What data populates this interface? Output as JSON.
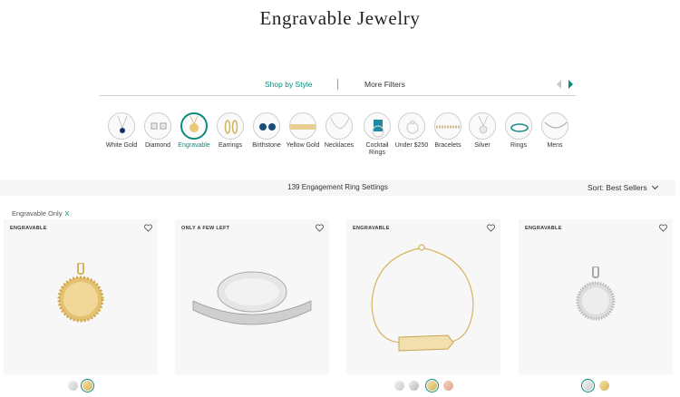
{
  "page": {
    "title": "Engravable Jewelry"
  },
  "filters": {
    "shop_by_style": "Shop by Style",
    "more_filters": "More Filters"
  },
  "styles": [
    {
      "label": "White Gold",
      "icon": "white-gold-pendant-icon"
    },
    {
      "label": "Diamond",
      "icon": "diamond-earrings-icon"
    },
    {
      "label": "Engravable",
      "icon": "engravable-pendant-icon",
      "active": true
    },
    {
      "label": "Earrings",
      "icon": "hoop-earrings-icon"
    },
    {
      "label": "Birthstone",
      "icon": "birthstone-earrings-icon"
    },
    {
      "label": "Yellow Gold",
      "icon": "yellow-gold-bracelet-icon"
    },
    {
      "label": "Necklaces",
      "icon": "necklace-icon"
    },
    {
      "label": "Cocktail Rings",
      "icon": "cocktail-ring-icon"
    },
    {
      "label": "Under $250",
      "icon": "under-250-ring-icon"
    },
    {
      "label": "Bracelets",
      "icon": "bracelet-icon"
    },
    {
      "label": "Silver",
      "icon": "silver-pendant-icon"
    },
    {
      "label": "Rings",
      "icon": "ring-icon"
    },
    {
      "label": "Mens",
      "icon": "mens-chain-icon"
    }
  ],
  "results": {
    "count_text": "139 Engagement Ring Settings",
    "sort_label": "Sort: Best Sellers"
  },
  "active_filter": {
    "label": "Engravable Only",
    "remove": "X"
  },
  "products": [
    {
      "badge": "ENGRAVABLE",
      "image": "gold-disc-pendant",
      "swatches": [
        "white",
        "yellow"
      ],
      "selected": 1
    },
    {
      "badge": "ONLY A FEW LEFT",
      "image": "signet-ring",
      "swatches": [],
      "selected": -1
    },
    {
      "badge": "ENGRAVABLE",
      "image": "gold-bar-bracelet",
      "swatches": [
        "white",
        "platinum",
        "yellow",
        "rose"
      ],
      "selected": 2
    },
    {
      "badge": "ENGRAVABLE",
      "image": "diamond-disc-pendant",
      "swatches": [
        "white",
        "yellow"
      ],
      "selected": 0
    }
  ],
  "colors": {
    "accent": "#0b8a7e",
    "card_bg": "#f7f7f7",
    "results_bg": "#f6f6f6"
  }
}
